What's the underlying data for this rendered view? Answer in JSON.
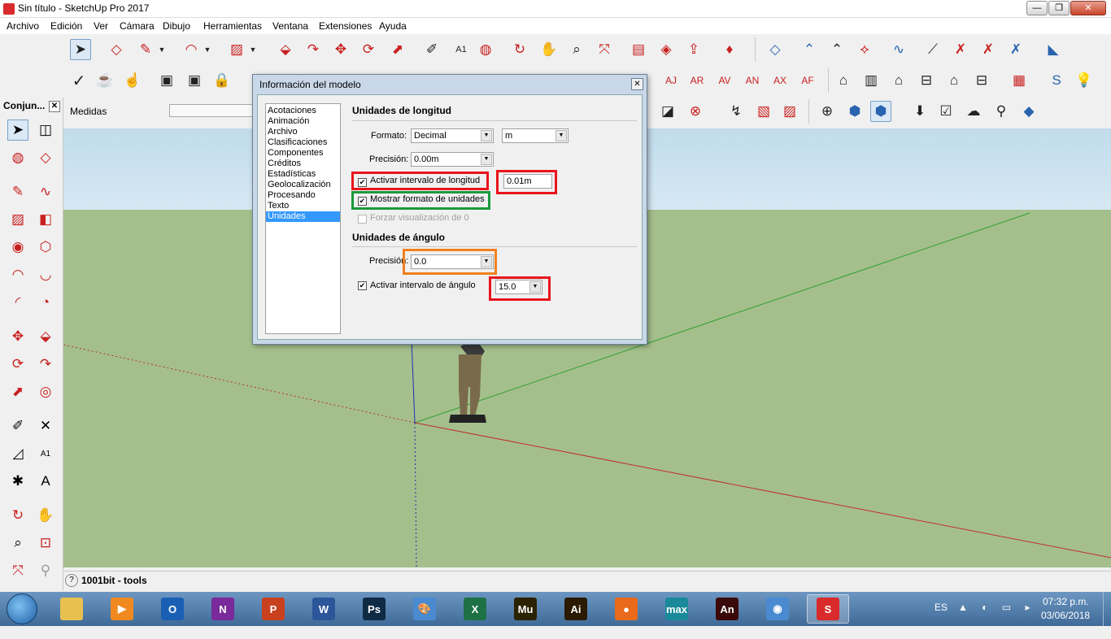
{
  "window": {
    "title": "Sin título - SketchUp Pro 2017",
    "minimize": "—",
    "maximize": "❐",
    "close": "✕"
  },
  "menu": [
    "Archivo",
    "Edición",
    "Ver",
    "Cámara",
    "Dibujo",
    "Herramientas",
    "Ventana",
    "Extensiones",
    "Ayuda"
  ],
  "measurements": {
    "label": "Medidas",
    "value": ""
  },
  "left_panel": {
    "title": "Conjun...",
    "close": "✕"
  },
  "status_bar": {
    "help": "?",
    "text": "1001bit - tools"
  },
  "dialog": {
    "title": "Información del modelo",
    "close": "✕",
    "categories": [
      "Acotaciones",
      "Animación",
      "Archivo",
      "Clasificaciones",
      "Componentes",
      "Créditos",
      "Estadísticas",
      "Geolocalización",
      "Procesando",
      "Texto",
      "Unidades"
    ],
    "selected_category": "Unidades",
    "length": {
      "heading": "Unidades de longitud",
      "format_label": "Formato:",
      "format_value": "Decimal",
      "unit_value": "m",
      "precision_label": "Precisión:",
      "precision_value": "0.00m",
      "snap_label": "Activar intervalo de longitud",
      "snap_checked": true,
      "snap_value": "0.01m",
      "show_format_label": "Mostrar formato de unidades",
      "show_format_checked": true,
      "force_label": "Forzar visualización de 0",
      "force_checked": false
    },
    "angle": {
      "heading": "Unidades de ángulo",
      "precision_label": "Precisión:",
      "precision_value": "0.0",
      "snap_label": "Activar intervalo de ángulo",
      "snap_checked": true,
      "snap_value": "15.0"
    },
    "highlight_colors": {
      "red": "#e8141c",
      "green": "#1a9a3a",
      "orange": "#f08020"
    }
  },
  "taskbar": {
    "apps": [
      {
        "name": "explorer",
        "label": "",
        "color": "#e8c050"
      },
      {
        "name": "media",
        "label": "▶",
        "color": "#f08a20"
      },
      {
        "name": "outlook",
        "label": "O",
        "color": "#1a5fb4"
      },
      {
        "name": "onenote",
        "label": "N",
        "color": "#7a2a9a"
      },
      {
        "name": "powerpoint",
        "label": "P",
        "color": "#c8401e"
      },
      {
        "name": "word",
        "label": "W",
        "color": "#2b579a"
      },
      {
        "name": "photoshop",
        "label": "Ps",
        "color": "#0f2a44"
      },
      {
        "name": "paint",
        "label": "🎨",
        "color": "#4a8ad0"
      },
      {
        "name": "excel",
        "label": "X",
        "color": "#1e7145"
      },
      {
        "name": "muse",
        "label": "Mu",
        "color": "#2a2200"
      },
      {
        "name": "illustrator",
        "label": "Ai",
        "color": "#2a1a00"
      },
      {
        "name": "firefox",
        "label": "●",
        "color": "#e86a1a"
      },
      {
        "name": "3dsmax",
        "label": "max",
        "color": "#1a8a9a"
      },
      {
        "name": "animate",
        "label": "An",
        "color": "#3a0a0a"
      },
      {
        "name": "chrome",
        "label": "◉",
        "color": "#4a8ad0"
      },
      {
        "name": "sketchup",
        "label": "S",
        "color": "#d92b2b"
      }
    ],
    "language": "ES",
    "tray": "▲ ◐ ▭ ▸",
    "time": "07:32 p.m.",
    "date": "03/06/2018"
  }
}
